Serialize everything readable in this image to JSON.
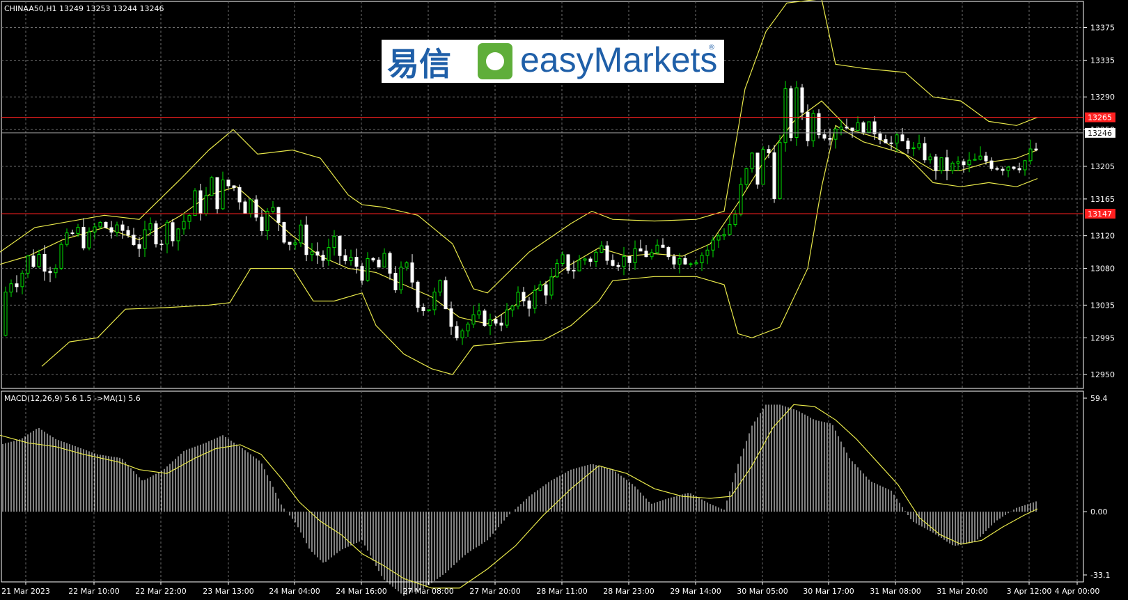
{
  "colors": {
    "background": "#000000",
    "grid": "#6b6b6b",
    "candle_up": "#00e000",
    "candle_down": "#ffffff",
    "band": "#e8e84a",
    "level_line": "#ff2020",
    "macd_hist": "#ffffff",
    "macd_signal": "#e8e84a",
    "axis_text": "#ffffff"
  },
  "header": {
    "title": "CHINAA50,H1  13249 13253 13244 13246"
  },
  "logo": {
    "cn_text": "易信",
    "brand_text": "easyMarkets",
    "reg_mark": "®"
  },
  "chart_data": [
    {
      "type": "candlestick",
      "symbol": "CHINAA50",
      "timeframe": "H1",
      "y_ticks": [
        "13375",
        "13335",
        "13290",
        "13250",
        "13205",
        "13165",
        "13120",
        "13080",
        "13035",
        "12995",
        "12950"
      ],
      "ylim": [
        12933,
        13407
      ],
      "levels": [
        {
          "value": 13265,
          "label": "13265"
        },
        {
          "value": 13147,
          "label": "13147"
        }
      ],
      "current_price": {
        "value": 13246,
        "label": "13246"
      },
      "x_ticks": [
        "21 Mar 2023",
        "22 Mar 10:00",
        "22 Mar 22:00",
        "23 Mar 13:00",
        "24 Mar 04:00",
        "24 Mar 16:00",
        "27 Mar 08:00",
        "27 Mar 20:00",
        "28 Mar 11:00",
        "28 Mar 23:00",
        "29 Mar 14:00",
        "30 Mar 05:00",
        "30 Mar 17:00",
        "31 Mar 08:00",
        "31 Mar 20:00",
        "3 Apr 12:00",
        "4 Apr 00:00"
      ],
      "bollinger": {
        "middle": [
          [
            0,
            13085
          ],
          [
            40,
            13095
          ],
          [
            90,
            13115
          ],
          [
            150,
            13130
          ],
          [
            200,
            13115
          ],
          [
            260,
            13145
          ],
          [
            300,
            13170
          ],
          [
            340,
            13180
          ],
          [
            380,
            13150
          ],
          [
            420,
            13120
          ],
          [
            460,
            13095
          ],
          [
            500,
            13080
          ],
          [
            540,
            13075
          ],
          [
            580,
            13060
          ],
          [
            620,
            13045
          ],
          [
            660,
            13020
          ],
          [
            700,
            13012
          ],
          [
            740,
            13035
          ],
          [
            780,
            13060
          ],
          [
            820,
            13085
          ],
          [
            860,
            13105
          ],
          [
            900,
            13095
          ],
          [
            940,
            13098
          ],
          [
            980,
            13095
          ],
          [
            1020,
            13110
          ],
          [
            1060,
            13160
          ],
          [
            1100,
            13215
          ],
          [
            1140,
            13260
          ],
          [
            1180,
            13285
          ],
          [
            1220,
            13250
          ],
          [
            1260,
            13240
          ],
          [
            1300,
            13220
          ],
          [
            1340,
            13200
          ],
          [
            1380,
            13200
          ],
          [
            1420,
            13210
          ],
          [
            1460,
            13215
          ],
          [
            1490,
            13225
          ]
        ],
        "upper": [
          [
            0,
            13100
          ],
          [
            50,
            13130
          ],
          [
            150,
            13145
          ],
          [
            200,
            13140
          ],
          [
            260,
            13190
          ],
          [
            300,
            13225
          ],
          [
            335,
            13250
          ],
          [
            370,
            13220
          ],
          [
            420,
            13225
          ],
          [
            460,
            13215
          ],
          [
            500,
            13170
          ],
          [
            520,
            13158
          ],
          [
            550,
            13155
          ],
          [
            600,
            13145
          ],
          [
            650,
            13110
          ],
          [
            680,
            13055
          ],
          [
            700,
            13050
          ],
          [
            760,
            13100
          ],
          [
            820,
            13135
          ],
          [
            850,
            13150
          ],
          [
            880,
            13140
          ],
          [
            940,
            13138
          ],
          [
            1000,
            13140
          ],
          [
            1040,
            13150
          ],
          [
            1070,
            13300
          ],
          [
            1100,
            13370
          ],
          [
            1130,
            13405
          ],
          [
            1180,
            13410
          ],
          [
            1200,
            13330
          ],
          [
            1240,
            13325
          ],
          [
            1300,
            13320
          ],
          [
            1340,
            13290
          ],
          [
            1380,
            13285
          ],
          [
            1420,
            13260
          ],
          [
            1460,
            13255
          ],
          [
            1490,
            13265
          ]
        ],
        "lower": [
          [
            60,
            12960
          ],
          [
            100,
            12990
          ],
          [
            140,
            12995
          ],
          [
            180,
            13030
          ],
          [
            240,
            13032
          ],
          [
            300,
            13035
          ],
          [
            330,
            13038
          ],
          [
            360,
            13080
          ],
          [
            420,
            13080
          ],
          [
            450,
            13040
          ],
          [
            480,
            13040
          ],
          [
            520,
            13050
          ],
          [
            540,
            13010
          ],
          [
            580,
            12975
          ],
          [
            620,
            12957
          ],
          [
            650,
            12950
          ],
          [
            680,
            12985
          ],
          [
            740,
            12990
          ],
          [
            780,
            12992
          ],
          [
            820,
            13010
          ],
          [
            860,
            13040
          ],
          [
            880,
            13065
          ],
          [
            940,
            13070
          ],
          [
            1000,
            13070
          ],
          [
            1040,
            13060
          ],
          [
            1060,
            13000
          ],
          [
            1080,
            12995
          ],
          [
            1120,
            13008
          ],
          [
            1160,
            13080
          ],
          [
            1180,
            13180
          ],
          [
            1200,
            13255
          ],
          [
            1240,
            13235
          ],
          [
            1300,
            13220
          ],
          [
            1340,
            13185
          ],
          [
            1380,
            13180
          ],
          [
            1420,
            13185
          ],
          [
            1460,
            13180
          ],
          [
            1490,
            13190
          ]
        ]
      }
    },
    {
      "type": "macd",
      "label": "MACD(12,26,9) 5.6 1.5  ->MA(1) 5.6",
      "y_ticks": [
        "59.4",
        "0.00",
        "-33.1"
      ],
      "ylim": [
        -33.1,
        59.4
      ],
      "histogram": [
        [
          0,
          35
        ],
        [
          30,
          38
        ],
        [
          55,
          44
        ],
        [
          80,
          38
        ],
        [
          110,
          34
        ],
        [
          140,
          30
        ],
        [
          175,
          28
        ],
        [
          205,
          16
        ],
        [
          235,
          22
        ],
        [
          265,
          32
        ],
        [
          295,
          36
        ],
        [
          320,
          40
        ],
        [
          345,
          34
        ],
        [
          375,
          26
        ],
        [
          405,
          3
        ],
        [
          425,
          -6
        ],
        [
          445,
          -20
        ],
        [
          465,
          -27
        ],
        [
          490,
          -20
        ],
        [
          520,
          -15
        ],
        [
          550,
          -35
        ],
        [
          580,
          -44
        ],
        [
          610,
          -40
        ],
        [
          640,
          -32
        ],
        [
          670,
          -22
        ],
        [
          700,
          -15
        ],
        [
          730,
          -2
        ],
        [
          760,
          8
        ],
        [
          790,
          16
        ],
        [
          820,
          22
        ],
        [
          850,
          25
        ],
        [
          880,
          22
        ],
        [
          910,
          14
        ],
        [
          935,
          4
        ],
        [
          960,
          7
        ],
        [
          990,
          10
        ],
        [
          1020,
          4
        ],
        [
          1040,
          1
        ],
        [
          1060,
          25
        ],
        [
          1080,
          45
        ],
        [
          1100,
          56
        ],
        [
          1120,
          56
        ],
        [
          1145,
          53
        ],
        [
          1170,
          48
        ],
        [
          1195,
          46
        ],
        [
          1220,
          28
        ],
        [
          1250,
          16
        ],
        [
          1280,
          11
        ],
        [
          1310,
          -5
        ],
        [
          1340,
          -11
        ],
        [
          1370,
          -18
        ],
        [
          1400,
          -16
        ],
        [
          1430,
          -5
        ],
        [
          1460,
          2
        ],
        [
          1490,
          5.6
        ]
      ],
      "signal": [
        [
          0,
          40
        ],
        [
          40,
          36
        ],
        [
          80,
          34
        ],
        [
          120,
          30
        ],
        [
          170,
          26
        ],
        [
          200,
          22
        ],
        [
          240,
          20
        ],
        [
          280,
          28
        ],
        [
          310,
          33
        ],
        [
          345,
          35
        ],
        [
          375,
          30
        ],
        [
          405,
          17
        ],
        [
          430,
          5
        ],
        [
          460,
          -5
        ],
        [
          490,
          -12
        ],
        [
          520,
          -22
        ],
        [
          550,
          -28
        ],
        [
          580,
          -35
        ],
        [
          620,
          -40
        ],
        [
          660,
          -40
        ],
        [
          700,
          -30
        ],
        [
          740,
          -18
        ],
        [
          780,
          -2
        ],
        [
          820,
          12
        ],
        [
          860,
          24
        ],
        [
          900,
          20
        ],
        [
          940,
          12
        ],
        [
          980,
          8
        ],
        [
          1020,
          7
        ],
        [
          1050,
          8
        ],
        [
          1080,
          24
        ],
        [
          1110,
          44
        ],
        [
          1140,
          56
        ],
        [
          1170,
          55
        ],
        [
          1200,
          48
        ],
        [
          1230,
          38
        ],
        [
          1260,
          26
        ],
        [
          1290,
          14
        ],
        [
          1320,
          -3
        ],
        [
          1350,
          -12
        ],
        [
          1380,
          -17
        ],
        [
          1410,
          -15
        ],
        [
          1440,
          -8
        ],
        [
          1470,
          -2
        ],
        [
          1490,
          1.5
        ]
      ]
    }
  ]
}
